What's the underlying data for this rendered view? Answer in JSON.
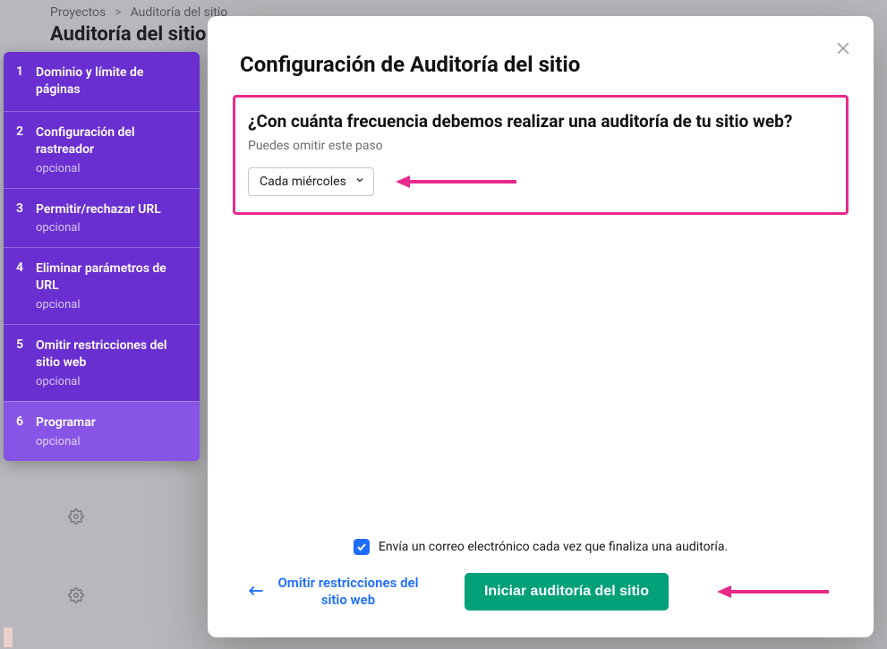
{
  "breadcrumb": {
    "root": "Proyectos",
    "current": "Auditoría del sitio"
  },
  "page_title": "Auditoría del sitio",
  "stepper": {
    "optional_label": "opcional",
    "items": [
      {
        "num": "1",
        "label": "Dominio y límite de páginas",
        "optional": false
      },
      {
        "num": "2",
        "label": "Configuración del rastreador",
        "optional": true
      },
      {
        "num": "3",
        "label": "Permitir/rechazar URL",
        "optional": true
      },
      {
        "num": "4",
        "label": "Eliminar parámetros de URL",
        "optional": true
      },
      {
        "num": "5",
        "label": "Omitir restricciones del sitio web",
        "optional": true
      },
      {
        "num": "6",
        "label": "Programar",
        "optional": true,
        "active": true
      }
    ]
  },
  "modal": {
    "title": "Configuración de Auditoría del sitio",
    "question": "¿Con cuánta frecuencia debemos realizar una auditoría de tu sitio web?",
    "hint": "Puedes omitir este paso",
    "select_value": "Cada miércoles",
    "email_checkbox_label": "Envía un correo electrónico cada vez que finaliza una auditoría.",
    "back_link": "Omitir restricciones del sitio web",
    "primary_button": "Iniciar auditoría del sitio"
  },
  "colors": {
    "annotation_pink": "#e82a8a",
    "stepper_purple": "#6a2fd0",
    "stepper_active": "#8754e6",
    "primary_green": "#00a078",
    "link_blue": "#1f6dff"
  }
}
